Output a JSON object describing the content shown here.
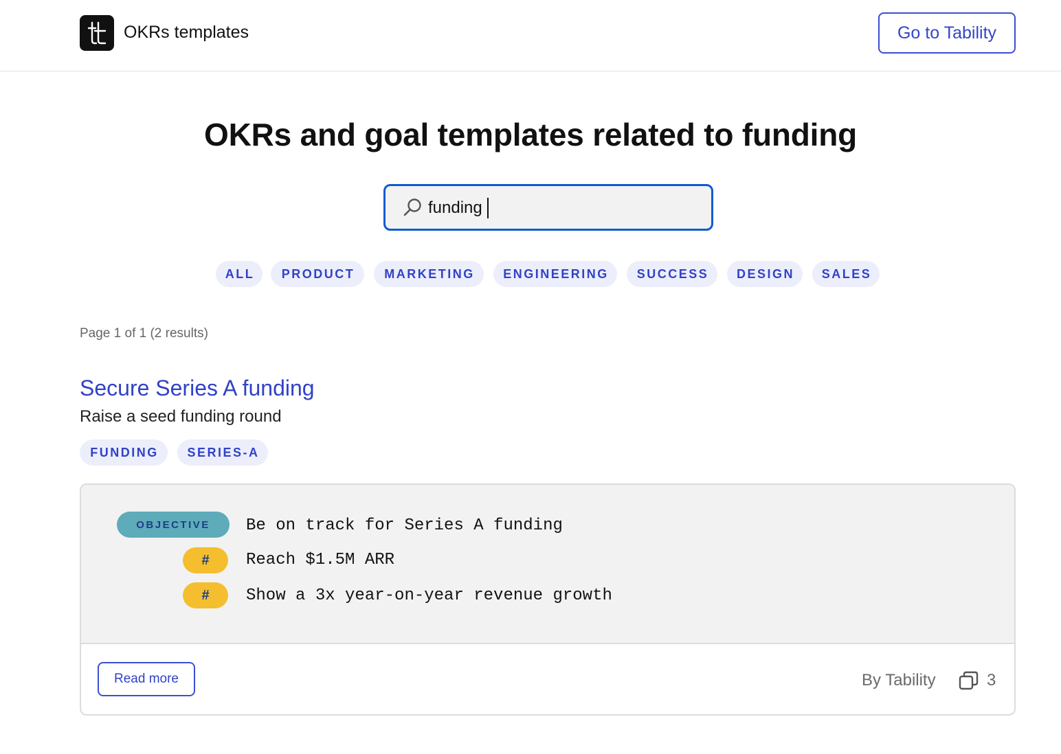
{
  "header": {
    "brand": "OKRs templates",
    "cta_label": "Go to Tability"
  },
  "main": {
    "title": "OKRs and goal templates related to funding",
    "search": {
      "value": "funding",
      "placeholder": ""
    },
    "filters": [
      "ALL",
      "PRODUCT",
      "MARKETING",
      "ENGINEERING",
      "SUCCESS",
      "DESIGN",
      "SALES"
    ],
    "page_info": "Page 1 of 1 (2 results)"
  },
  "results": [
    {
      "title": "Secure Series A funding",
      "subtitle": "Raise a seed funding round",
      "tags": [
        "FUNDING",
        "SERIES-A"
      ],
      "objective_badge": "OBJECTIVE",
      "objective": "Be on track for Series A funding",
      "kr_badge": "#",
      "key_results": [
        "Reach $1.5M ARR",
        "Show a 3x year-on-year revenue growth"
      ],
      "read_more": "Read more",
      "author": "By Tability",
      "copies": "3"
    }
  ],
  "colors": {
    "accent": "#3142c6",
    "chip_bg": "#eceefb",
    "objective_badge": "#5eabb9",
    "kr_badge": "#f4be2e",
    "search_border": "#0d5bd1"
  },
  "icons": [
    "tability-logo-icon",
    "search-icon",
    "copy-icon"
  ]
}
